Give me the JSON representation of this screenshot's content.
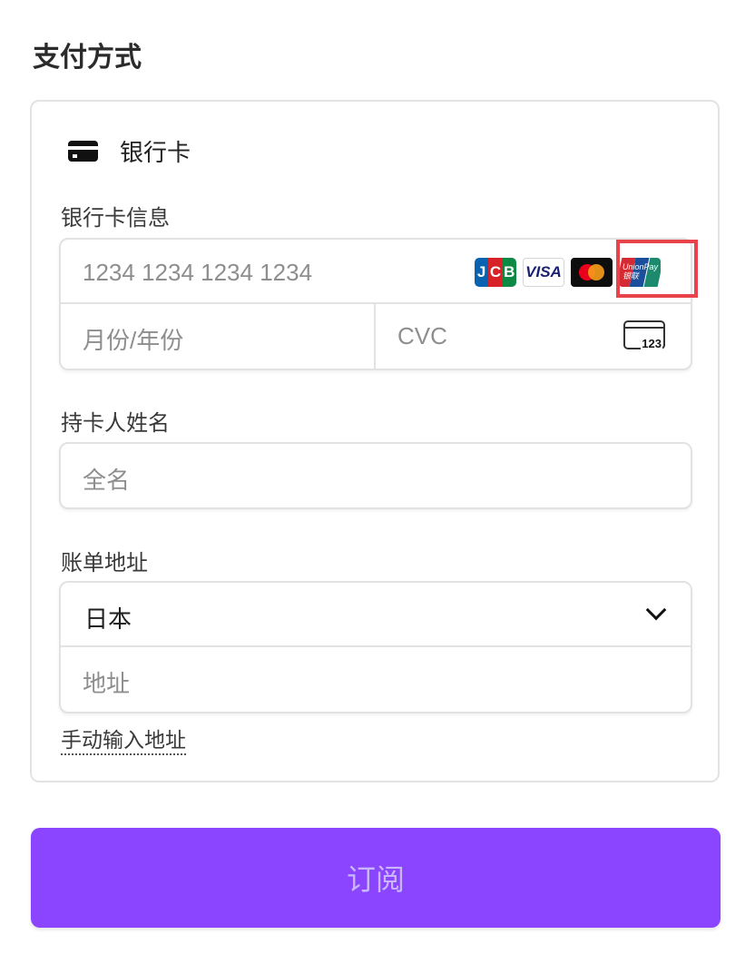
{
  "header": {
    "title": "支付方式"
  },
  "method": {
    "label": "银行卡",
    "icon": "credit-card-icon"
  },
  "card_info": {
    "label": "银行卡信息",
    "number_placeholder": "1234 1234 1234 1234",
    "expiry_placeholder": "月份/年份",
    "cvc_placeholder": "CVC",
    "cvc_icon_text": "123",
    "brands": [
      {
        "name": "JCB",
        "letters": [
          "J",
          "C",
          "B"
        ],
        "icon": "jcb-logo-icon"
      },
      {
        "name": "VISA",
        "icon": "visa-logo-icon"
      },
      {
        "name": "Mastercard",
        "icon": "mastercard-logo-icon"
      },
      {
        "name": "UnionPay",
        "text": "UnionPay 银联",
        "icon": "unionpay-logo-icon"
      }
    ],
    "highlight_color": "#e8434a"
  },
  "cardholder": {
    "label": "持卡人姓名",
    "placeholder": "全名"
  },
  "billing": {
    "label": "账单地址",
    "country_value": "日本",
    "address_placeholder": "地址",
    "manual_link": "手动输入地址"
  },
  "submit": {
    "label": "订阅",
    "bg_color": "#8c45ff"
  }
}
